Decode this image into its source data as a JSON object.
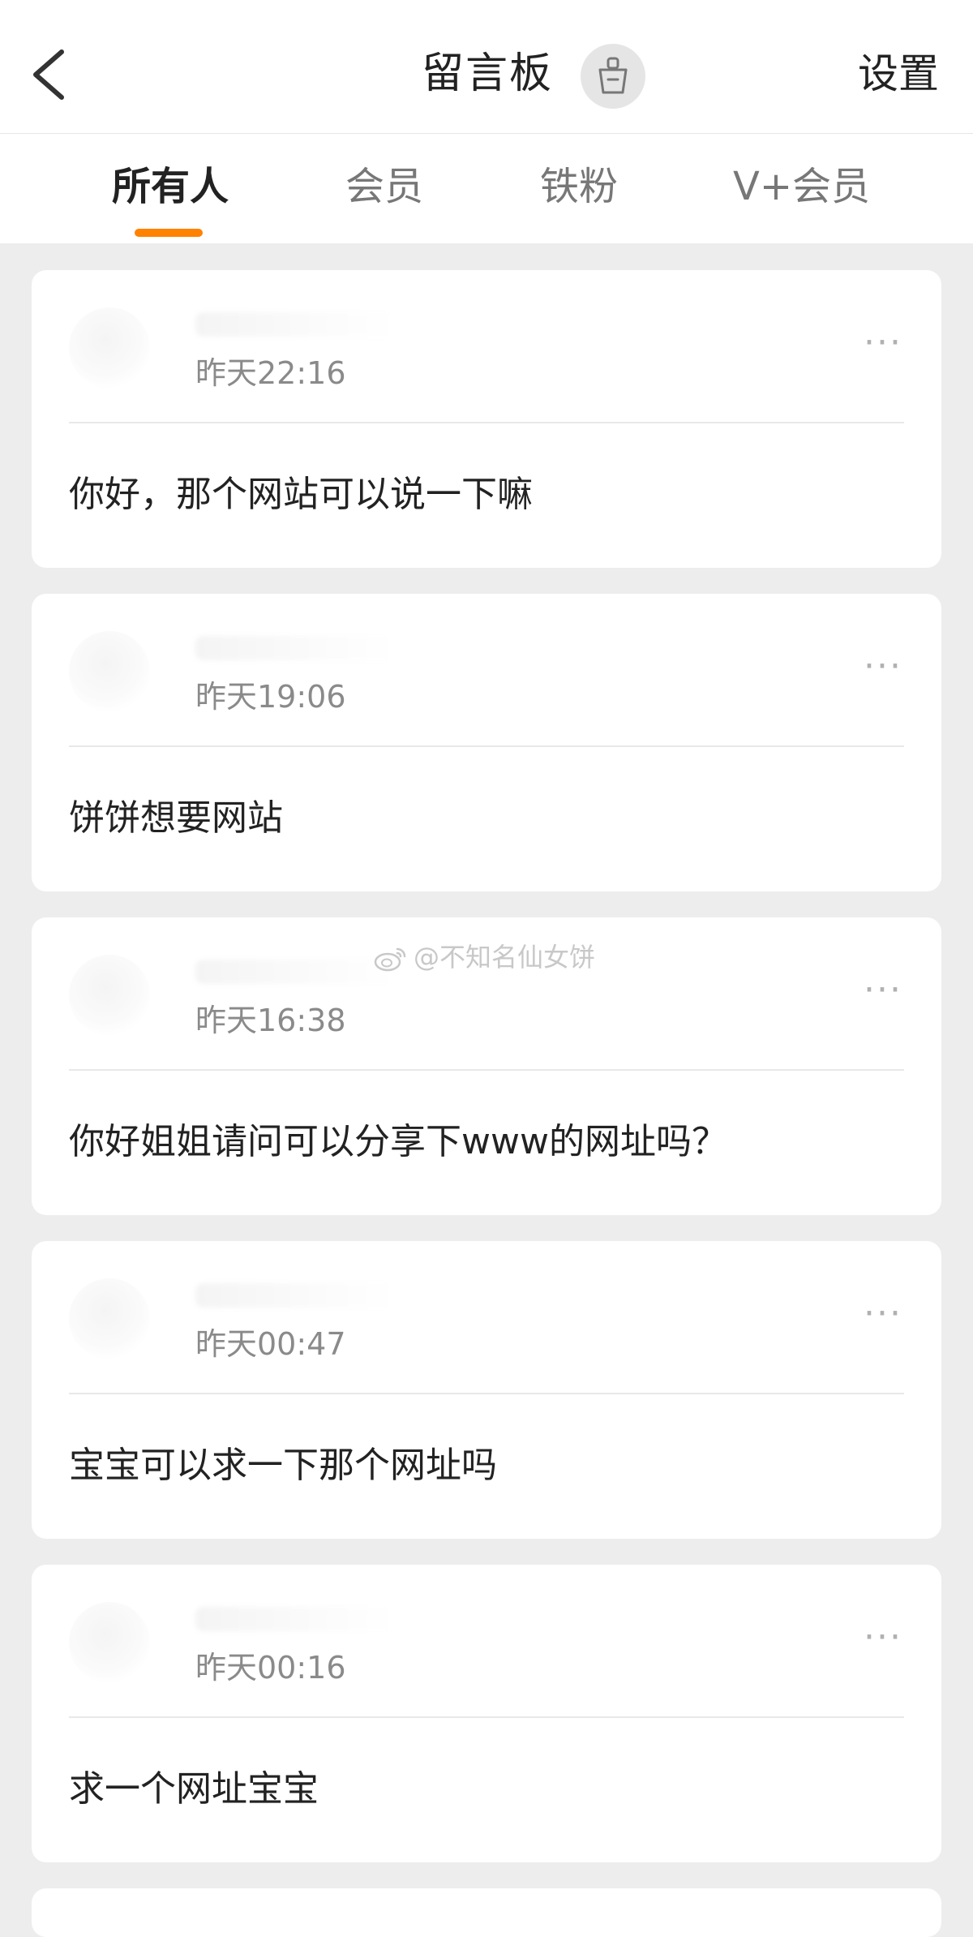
{
  "header": {
    "title": "留言板",
    "settings_label": "设置",
    "back_icon": "chevron-left-icon",
    "clean_icon": "broom-icon"
  },
  "tabs": [
    {
      "label": "所有人",
      "active": true
    },
    {
      "label": "会员",
      "active": false
    },
    {
      "label": "铁粉",
      "active": false
    },
    {
      "label": "V+会员",
      "active": false
    }
  ],
  "messages": [
    {
      "time": "昨天22:16",
      "text": "你好，那个网站可以说一下嘛"
    },
    {
      "time": "昨天19:06",
      "text": "饼饼想要网站"
    },
    {
      "time": "昨天16:38",
      "text": "你好姐姐请问可以分享下www的网址吗？"
    },
    {
      "time": "昨天00:47",
      "text": "宝宝可以求一下那个网址吗"
    },
    {
      "time": "昨天00:16",
      "text": "求一个网址宝宝"
    }
  ],
  "watermark": {
    "text": "@不知名仙女饼",
    "icon": "weibo-logo-icon"
  },
  "colors": {
    "accent": "#ff8200",
    "background": "#ededed",
    "card": "#ffffff",
    "secondary_text": "#8a8a8a"
  }
}
